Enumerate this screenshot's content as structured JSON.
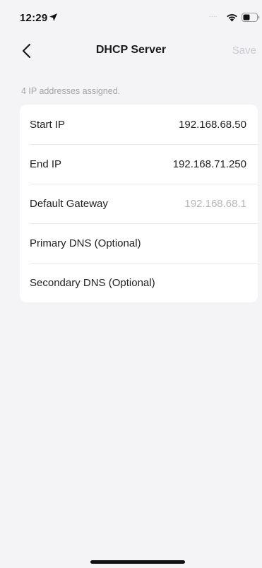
{
  "status_bar": {
    "time": "12:29",
    "signal": "....",
    "icons": [
      "location-arrow-icon",
      "wifi-icon",
      "battery-icon"
    ]
  },
  "nav": {
    "title": "DHCP Server",
    "save_label": "Save",
    "back_icon": "chevron-left-icon"
  },
  "hint": "4 IP addresses assigned.",
  "fields": [
    {
      "label": "Start IP",
      "value": "192.168.68.50"
    },
    {
      "label": "End IP",
      "value": "192.168.71.250"
    },
    {
      "label": "Default Gateway",
      "value": "192.168.68.1"
    },
    {
      "label": "Primary DNS (Optional)",
      "value": ""
    },
    {
      "label": "Secondary DNS (Optional)",
      "value": ""
    }
  ],
  "colors": {
    "background": "#f4f4f7",
    "card": "#ffffff",
    "disabled_text": "#c9c9cf",
    "hint_text": "#a3a3a8"
  }
}
